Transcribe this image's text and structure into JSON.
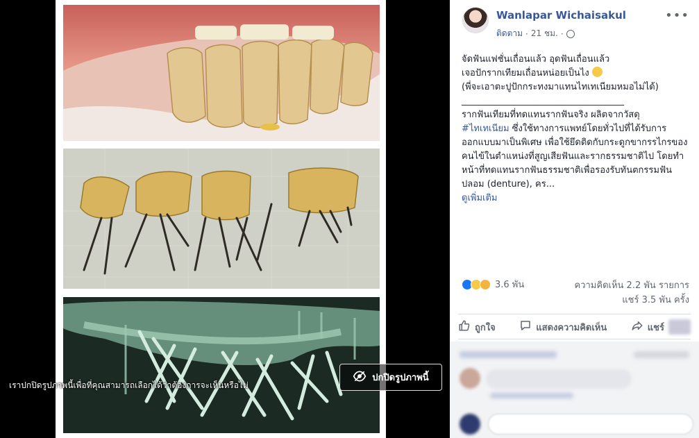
{
  "viewer": {
    "hide_notice": "เราปกปิดรูปภาพนี้เพื่อที่คุณสามารถเลือกได้ว่าต้องการจะเห็นหรือไม่",
    "hide_button_label": "ปกปิดรูปภาพนี้",
    "eye_icon": "eye-icon"
  },
  "post": {
    "author": "Wanlapar Wichaisakul",
    "follow_label": "ติดตาม",
    "time": "21 ชม.",
    "privacy_icon": "globe-icon",
    "line1": "จัดฟันแฟชั่นเถื่อนแล้ว อุดฟันเถื่อนแล้ว",
    "line2": "เจอปักรากเทียมเถื่อนหน่อยเป็นไง",
    "line3": "(พี่จะเอาตะปูปักกระทงมาแทนไทเทเนียมหมอไม่ได้)",
    "separator": "____________________________________",
    "body_before": "รากฟันเทียมที่ทดแทนรากฟันจริง ผลิตจากวัสดุ",
    "hashtag": "#ไทเทเนียม",
    "body_after": " ซึ่งใช้ทางการแพทย์โดยทั่วไปที่ได้รับการออกแบบมาเป็นพิเศษ เพื่อใช้ยึดติดกับกระดูกขากรรไกรของคนไข้ในตำแหน่งที่สูญเสียฟันและรากธรรมชาติไป โดยทำหน้าที่ทดแทนรากฟันธรรมชาติเพื่อรองรับทันตกรรมฟันปลอม (denture), คร...",
    "see_more": "ดูเพิ่มเติม"
  },
  "reactions": {
    "count": "3.6 พัน",
    "comments": "ความคิดเห็น 2.2 พัน รายการ",
    "shares": "แชร์ 3.5 พัน ครั้ง"
  },
  "actions": {
    "like": "ถูกใจ",
    "comment": "แสดงความคิดเห็น",
    "share": "แชร์"
  },
  "colors": {
    "link": "#385898",
    "like_blue": "#1877f2",
    "text": "#1d2129",
    "muted": "#606770"
  }
}
